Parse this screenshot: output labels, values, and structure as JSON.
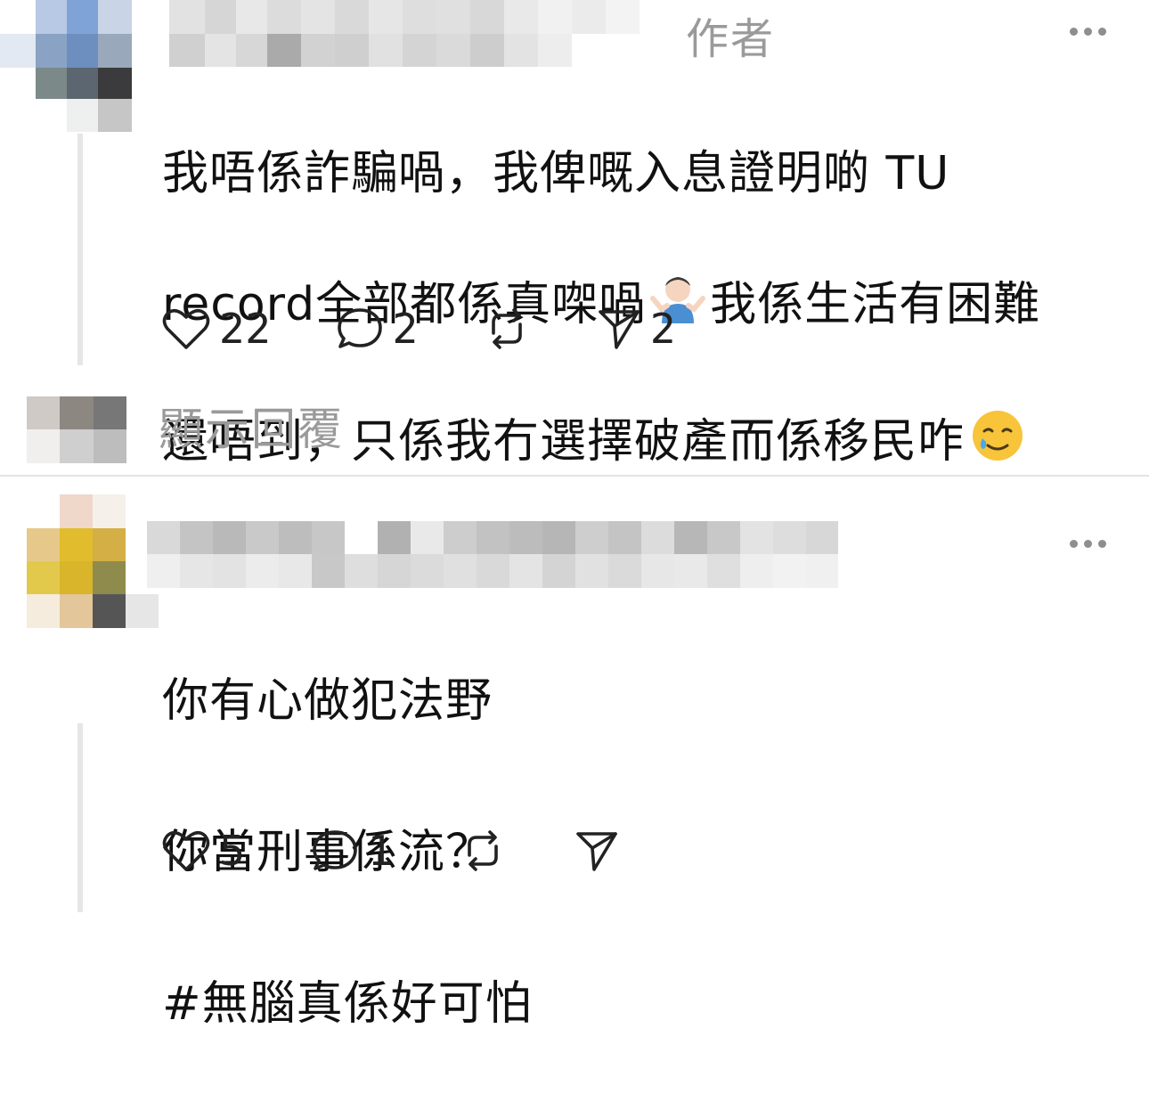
{
  "comment1": {
    "author_tag": "作者",
    "text_lines": [
      "我唔係詐騙喎，我俾嘅入息證明啲 TU",
      "record全部都係真㗎喎",
      "我係生活有困難",
      "還唔到，只係我冇選擇破產而係移民咋"
    ],
    "actions": {
      "like_count": "22",
      "reply_count": "2",
      "repost_count": "",
      "share_count": "2"
    },
    "emojis": [
      "person-shrugging",
      "smiling-face-with-tear"
    ]
  },
  "show_replies_label": "顯示回覆",
  "comment2": {
    "text_lines": [
      "你有心做犯法野",
      "你當刑事係流？",
      "#無腦真係好可怕"
    ],
    "actions": {
      "like_count": "5",
      "reply_count": "1",
      "repost_count": "",
      "share_count": ""
    }
  },
  "colors": {
    "text": "#111111",
    "muted": "#9a9a9a",
    "icon": "#222222",
    "divider": "#e4e4e4"
  }
}
